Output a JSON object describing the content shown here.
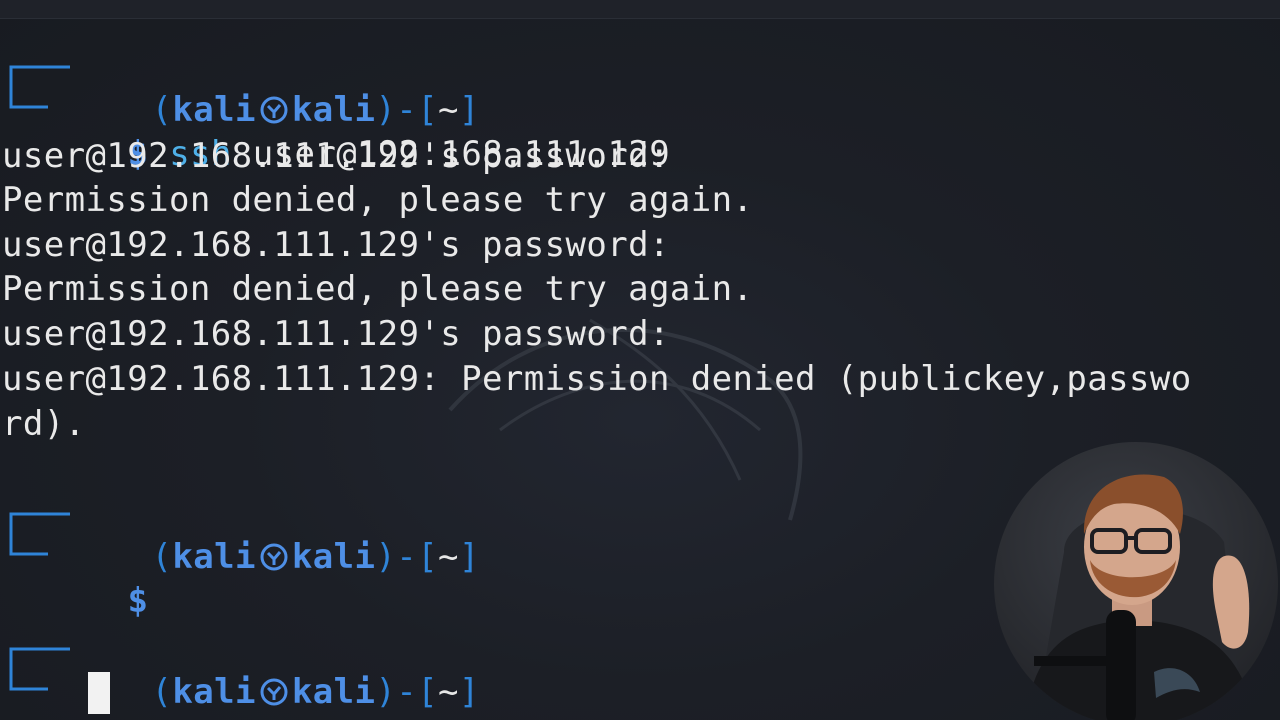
{
  "terminal": {
    "prompt": {
      "user": "kali",
      "host": "kali",
      "dir": "~",
      "symbol": "$"
    },
    "command1": {
      "name": "ssh",
      "args": "user@192.168.111.129"
    },
    "output": [
      "user@192.168.111.129's password:",
      "Permission denied, please try again.",
      "user@192.168.111.129's password:",
      "Permission denied, please try again.",
      "user@192.168.111.129's password:",
      "user@192.168.111.129: Permission denied (publickey,passwo",
      "rd)."
    ]
  },
  "colors": {
    "background": "#1b1e24",
    "prompt_blue": "#4e8fe6",
    "text": "#e9e9e9"
  },
  "icons": {
    "skull": "kali-skull-icon",
    "watermark": "kali-dragon-logo"
  }
}
